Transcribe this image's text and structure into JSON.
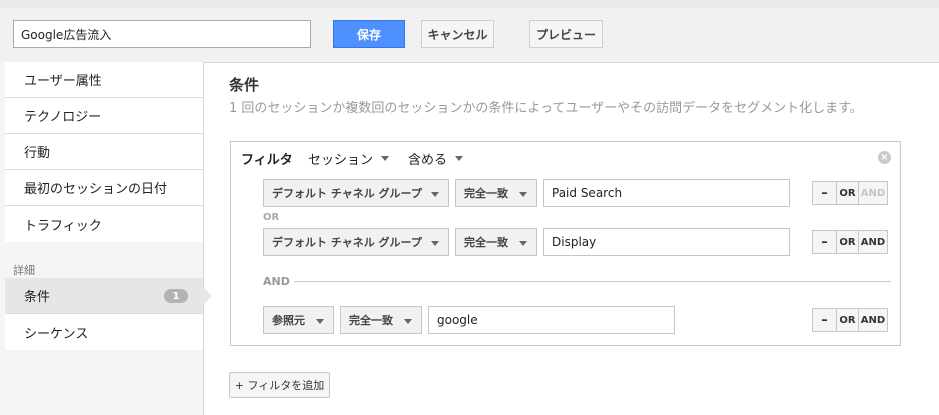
{
  "header": {
    "segment_name": "Google広告流入",
    "save_label": "保存",
    "cancel_label": "キャンセル",
    "preview_label": "プレビュー"
  },
  "sidebar": {
    "items": [
      {
        "label": "ユーザー属性"
      },
      {
        "label": "テクノロジー"
      },
      {
        "label": "行動"
      },
      {
        "label": "最初のセッションの日付"
      },
      {
        "label": "トラフィック"
      }
    ],
    "advanced_heading": "詳細",
    "advanced_items": [
      {
        "label": "条件",
        "badge": "1",
        "active": true
      },
      {
        "label": "シーケンス"
      }
    ]
  },
  "main": {
    "title": "条件",
    "description": "1 回のセッションか複数回のセッションかの条件によってユーザーやその訪問データをセグメント化します。",
    "filter": {
      "heading": "フィルタ",
      "scope": "セッション",
      "mode": "含める",
      "close_icon": "close-icon",
      "or_label": "OR",
      "and_label": "AND",
      "conditions": [
        {
          "dimension": "デフォルト チャネル グループ",
          "operator": "完全一致",
          "value": "Paid Search"
        },
        {
          "dimension": "デフォルト チャネル グループ",
          "operator": "完全一致",
          "value": "Display"
        },
        {
          "dimension": "参照元",
          "operator": "完全一致",
          "value": "google"
        }
      ],
      "row_buttons": {
        "minus": "–",
        "or": "OR",
        "and": "AND"
      }
    },
    "add_filter_label": "+ フィルタを追加"
  },
  "colors": {
    "primary": "#4d90fe",
    "sidebar_bg": "#f5f5f5",
    "active_item": "#e6e6e6"
  }
}
